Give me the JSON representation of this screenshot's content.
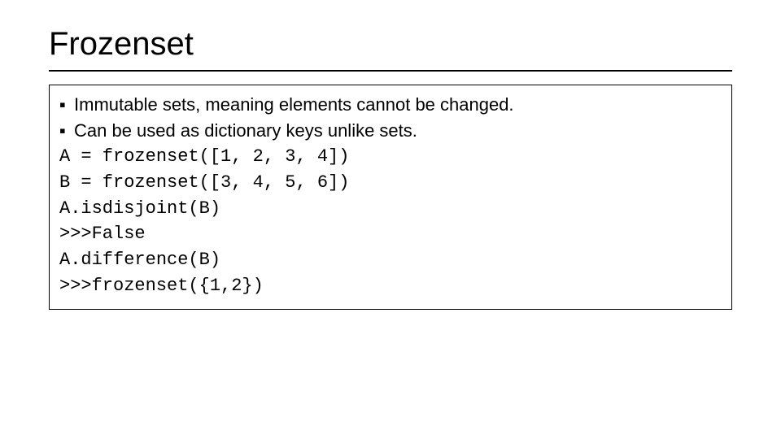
{
  "title": "Frozenset",
  "bullets": [
    "Immutable sets, meaning elements cannot be changed.",
    "Can be used as dictionary keys unlike sets."
  ],
  "code_lines": [
    "A = frozenset([1, 2, 3, 4])",
    "B = frozenset([3, 4, 5, 6])",
    "A.isdisjoint(B)",
    ">>>False",
    "A.difference(B)",
    ">>>frozenset({1,2})"
  ]
}
